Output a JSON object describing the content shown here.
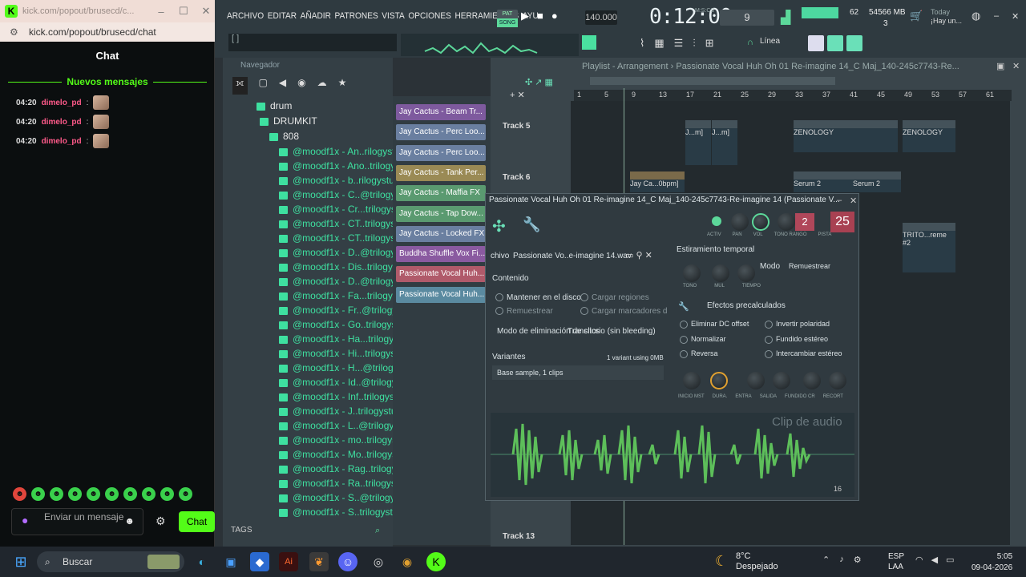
{
  "chat_window": {
    "title": "kick.com/popout/brusecd/c...",
    "url": "kick.com/popout/brusecd/chat",
    "header": "Chat",
    "new_messages": "Nuevos mensajes",
    "messages": [
      {
        "time": "04:20",
        "user": "dimelo_pd"
      },
      {
        "time": "04:20",
        "user": "dimelo_pd"
      },
      {
        "time": "04:20",
        "user": "dimelo_pd"
      }
    ],
    "input_placeholder": "Enviar un mensaje",
    "send_label": "Chat"
  },
  "fl": {
    "menu": [
      "ARCHIVO",
      "EDITAR",
      "AÑADIR",
      "PATRONES",
      "VISTA",
      "OPCIONES",
      "HERRAMIENTAS",
      "AYU"
    ],
    "pat_label": "PAT",
    "song_label": "SONG",
    "tempo": "140.000",
    "time": "0:12:00",
    "mcs": "M:S:CS",
    "pattern_num": "9",
    "cpu": "62",
    "memory": "54566 MB",
    "memory2": "3",
    "today_line1": "Today",
    "today_line2": "¡Hay un...",
    "linea": "Línea"
  },
  "browser": {
    "title": "Navegador",
    "folders": [
      "drum",
      "DRUMKIT",
      "808"
    ],
    "files": [
      "@moodf1x - An..rilogystuff",
      "@moodf1x - Ano..trilogystuff",
      "@moodf1x - b..rilogystuff★",
      "@moodf1x - C..@trilogystuff",
      "@moodf1x - Cr...trilogystuff",
      "@moodf1x - CT..trilogystuff",
      "@moodf1x - CT..trilogystuff",
      "@moodf1x - D..@trilogystuff",
      "@moodf1x - Dis..trilogystuff",
      "@moodf1x - D..@trilogystuff",
      "@moodf1x - Fa...trilogystuff",
      "@moodf1x - Fr..@trilogystuff",
      "@moodf1x - Go..trilogystuff",
      "@moodf1x - Ha...trilogystuff",
      "@moodf1x - Hi...trilogystuff",
      "@moodf1x - H...@trilogystuff",
      "@moodf1x - Id..@trilogystuff",
      "@moodf1x - Inf..trilogystuff",
      "@moodf1x - J..trilogystuff★",
      "@moodf1x - L..@trilogystuff",
      "@moodf1x - mo..trilogystuff",
      "@moodf1x - Mo..trilogystuff",
      "@moodf1x - Rag..trilogystuff",
      "@moodf1x - Ra..trilogystuff",
      "@moodf1x - S..@trilogystuff",
      "@moodf1x - S..trilogystuff★"
    ],
    "tags": "TAGS"
  },
  "clips": [
    {
      "label": "Jay Cactus - Beam Tr...",
      "color": "#7e5a9e"
    },
    {
      "label": "Jay Cactus - Perc Loo...",
      "color": "#6a7fa0"
    },
    {
      "label": "Jay Cactus - Perc Loo...",
      "color": "#6a7fa0"
    },
    {
      "label": "Jay Cactus - Tank Per...",
      "color": "#9a8a55"
    },
    {
      "label": "Jay Cactus - Maffia FX",
      "color": "#5a9a70"
    },
    {
      "label": "Jay Cactus - Tap Dow...",
      "color": "#5a9a70"
    },
    {
      "label": "Jay Cactus - Locked FX",
      "color": "#6a7fa0"
    },
    {
      "label": "Buddha Shuffle Vox Fi...",
      "color": "#8a5aa0"
    },
    {
      "label": "Passionate Vocal Huh...",
      "color": "#b05a6a"
    },
    {
      "label": "Passionate Vocal Huh...",
      "color": "#5a8aa0"
    }
  ],
  "playlist": {
    "title": "Playlist - Arrangement › Passionate Vocal Huh Oh 01 Re-imagine 14_C Maj_140-245c7743-Re...",
    "ruler": [
      "1",
      "5",
      "9",
      "13",
      "17",
      "21",
      "25",
      "29",
      "33",
      "37",
      "41",
      "45",
      "49",
      "53",
      "57",
      "61"
    ],
    "tracks": [
      "Track 5",
      "Track 6",
      "Track 13"
    ],
    "pclips": [
      "J...m]",
      "J...m]",
      "ZENOLOGY",
      "ZENOLOGY",
      "Jay Ca...0bpm]",
      "Serum 2",
      "Serum 2",
      "TRITO...reme #2"
    ]
  },
  "sample": {
    "title": "Passionate Vocal Huh Oh 01 Re-imagine 14_C Maj_140-245c7743-Re-imagine 14 (Passionate V...",
    "knob_labels": [
      "ACTIV",
      "PAN",
      "VOL",
      "TONO RANGO",
      "PISTA"
    ],
    "tone_range": "2",
    "pista": "25",
    "file_label": "chivo",
    "file_name": "Passionate Vo..e-imagine 14.wav",
    "contenido": "Contenido",
    "keep_disk": "Mantener en el disco",
    "load_regions": "Cargar regiones",
    "resample": "Remuestrear",
    "load_markers": "Cargar marcadores d",
    "declick_label": "Modo de eliminación de clics",
    "declick_value": "Transitorio (sin bleeding)",
    "variants": "Variantes",
    "variants_info": "1 variant using 0MB",
    "base_sample": "Base sample, 1 clips",
    "time_stretch": "Estiramiento temporal",
    "stretch_knobs": [
      "TONO",
      "MUL",
      "TIEMPO"
    ],
    "mode_label": "Modo",
    "mode_value": "Remuestrear",
    "precalc": "Efectos precalculados",
    "effects": [
      "Eliminar DC offset",
      "Invertir polaridad",
      "Normalizar",
      "Fundido estéreo",
      "Reversa",
      "Intercambiar estéreo"
    ],
    "env_knobs": [
      "INICIO MST",
      "DURA.",
      "ENTRA",
      "SALIDA",
      "FUNDIDO CR",
      "RECORT"
    ],
    "clip_label": "Clip de audio",
    "bits": "16"
  },
  "taskbar": {
    "search": "Buscar",
    "temp": "8°C",
    "weather": "Despejado",
    "lang1": "ESP",
    "lang2": "LAA",
    "time": "5:05",
    "date": "09-04-2026"
  }
}
